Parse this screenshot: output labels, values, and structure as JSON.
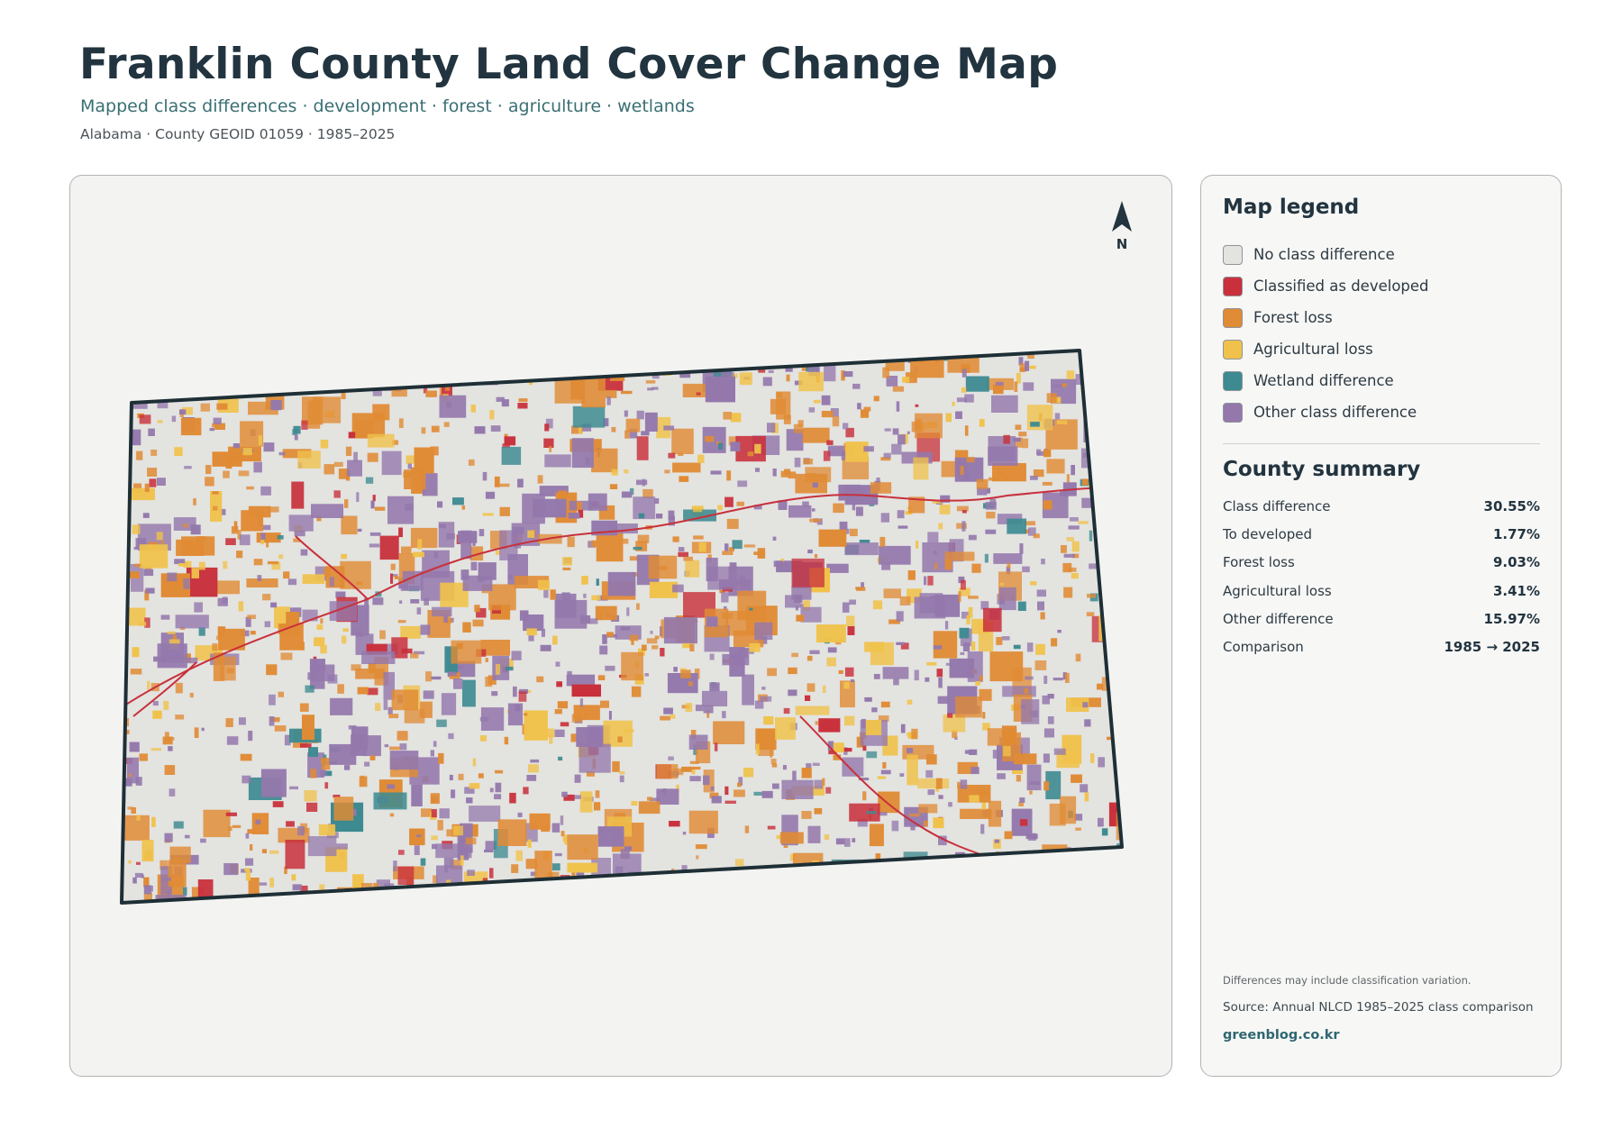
{
  "header": {
    "title": "Franklin County Land Cover Change Map",
    "subtitle": "Mapped class differences · development · forest · agriculture · wetlands",
    "meta": "Alabama · County GEOID 01059 · 1985–2025"
  },
  "map": {
    "north_label": "N",
    "colors": {
      "background": "#e3e3e0",
      "outline": "#1e2f36"
    }
  },
  "legend": {
    "title": "Map legend",
    "items": [
      {
        "label": "No class difference",
        "color": "#e3e3e0",
        "icon": "swatch-no-change"
      },
      {
        "label": "Classified as developed",
        "color": "#c8303b",
        "icon": "swatch-developed"
      },
      {
        "label": "Forest loss",
        "color": "#e08b35",
        "icon": "swatch-forest-loss"
      },
      {
        "label": "Agricultural loss",
        "color": "#f0c24b",
        "icon": "swatch-agricultural-loss"
      },
      {
        "label": "Wetland difference",
        "color": "#3d8a91",
        "icon": "swatch-wetland"
      },
      {
        "label": "Other class difference",
        "color": "#9478ac",
        "icon": "swatch-other"
      }
    ]
  },
  "summary": {
    "title": "County summary",
    "rows": [
      {
        "label": "Class difference",
        "value": "30.55%"
      },
      {
        "label": "To developed",
        "value": "1.77%"
      },
      {
        "label": "Forest loss",
        "value": "9.03%"
      },
      {
        "label": "Agricultural loss",
        "value": "3.41%"
      },
      {
        "label": "Other difference",
        "value": "15.97%"
      },
      {
        "label": "Comparison",
        "value": "1985 → 2025"
      }
    ]
  },
  "footer": {
    "note": "Differences may include classification variation.",
    "source": "Source: Annual NLCD 1985–2025 class comparison",
    "credit": "greenblog.co.kr"
  }
}
